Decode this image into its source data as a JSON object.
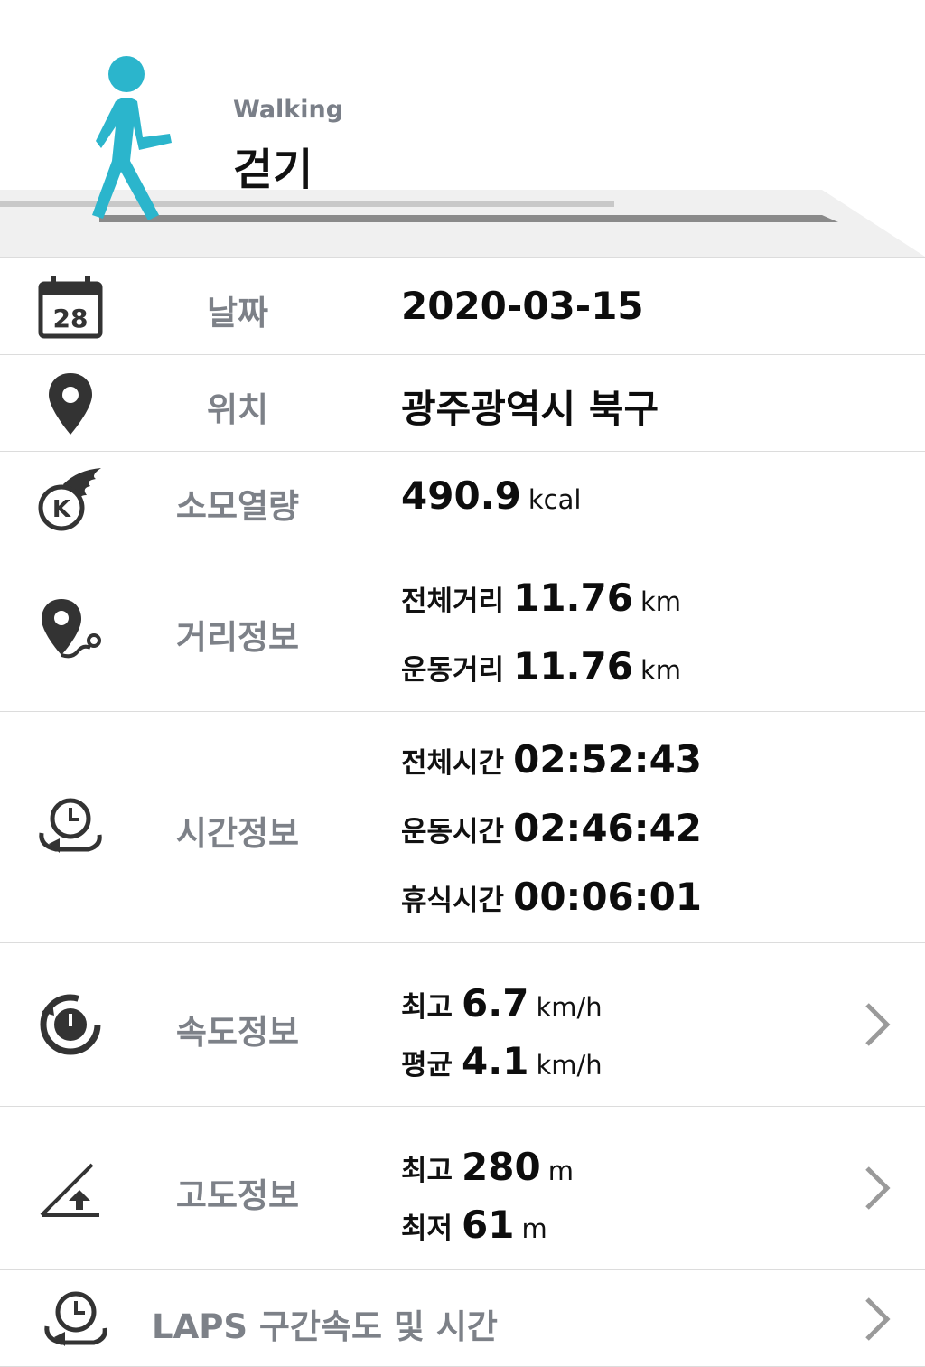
{
  "header": {
    "activity_en": "Walking",
    "activity_ko": "걷기",
    "accent": "#2bb5cc"
  },
  "rows": {
    "date": {
      "label": "날짜",
      "value": "2020-03-15",
      "icon": "calendar-icon",
      "icon_day": "28"
    },
    "location": {
      "label": "위치",
      "value": "광주광역시 북구",
      "icon": "map-pin-icon"
    },
    "calories": {
      "label": "소모열량",
      "value": "490.9",
      "unit": "kcal",
      "icon": "calorie-flame-icon",
      "icon_letter": "K"
    },
    "distance": {
      "label": "거리정보",
      "icon": "route-pin-icon",
      "total_label": "전체거리",
      "total_value": "11.76",
      "total_unit": "km",
      "exercise_label": "운동거리",
      "exercise_value": "11.76",
      "exercise_unit": "km"
    },
    "time": {
      "label": "시간정보",
      "icon": "clock-cycle-icon",
      "total_label": "전체시간",
      "total_value": "02:52:43",
      "exercise_label": "운동시간",
      "exercise_value": "02:46:42",
      "rest_label": "휴식시간",
      "rest_value": "00:06:01"
    },
    "speed": {
      "label": "속도정보",
      "icon": "speedometer-icon",
      "max_label": "최고",
      "max_value": "6.7",
      "max_unit": "km/h",
      "avg_label": "평균",
      "avg_value": "4.1",
      "avg_unit": "km/h"
    },
    "altitude": {
      "label": "고도정보",
      "icon": "altitude-slope-icon",
      "max_label": "최고",
      "max_value": "280",
      "max_unit": "m",
      "min_label": "최저",
      "min_value": "61",
      "min_unit": "m"
    },
    "laps": {
      "label": "LAPS 구간속도 및 시간",
      "icon": "lap-clock-icon"
    }
  }
}
